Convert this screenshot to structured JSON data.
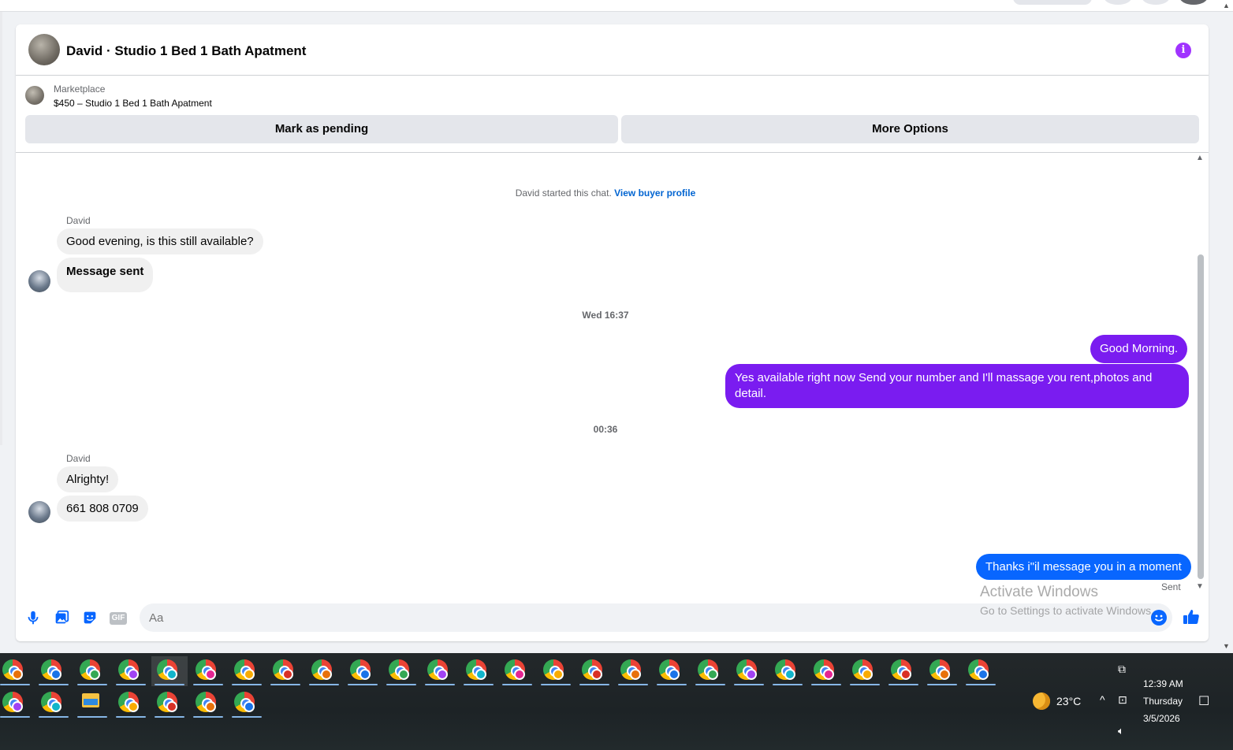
{
  "header": {
    "title": "David · Studio 1 Bed 1 Bath Apatment",
    "info_icon": "i"
  },
  "listing": {
    "category": "Marketplace",
    "price_title": "$450 – Studio 1 Bed 1 Bath Apatment",
    "mark_pending_label": "Mark as pending",
    "more_options_label": "More Options"
  },
  "chat": {
    "started_text": "David started this chat.",
    "view_profile_link": "View buyer profile",
    "sender1": "David",
    "msg1": "Good evening, is this still available?",
    "msg2": "Message sent",
    "time1": "Wed 16:37",
    "out1": "Good Morning.",
    "out2": "Yes available right now Send your number and I'll massage you rent,photos and detail.",
    "time2": "00:36",
    "sender2": "David",
    "msg3": "Alrighty!",
    "msg4": "661 808 0709",
    "out3": "Thanks i\"il message you in a moment",
    "status": "Sent"
  },
  "composer": {
    "placeholder": "Aa",
    "gif_label": "GIF"
  },
  "watermark": {
    "line1": "Activate Windows",
    "line2": "Go to Settings to activate Windows."
  },
  "taskbar": {
    "weather": "23°C",
    "time": "12:39 AM",
    "day": "Thursday",
    "date": "3/5/2026"
  },
  "colors": {
    "outgoing_purple": "#7a1cf0",
    "outgoing_blue": "#0866ff",
    "incoming_gray": "#f0f0f0",
    "link_blue": "#0064d1",
    "accent_purple": "#a033ff"
  }
}
